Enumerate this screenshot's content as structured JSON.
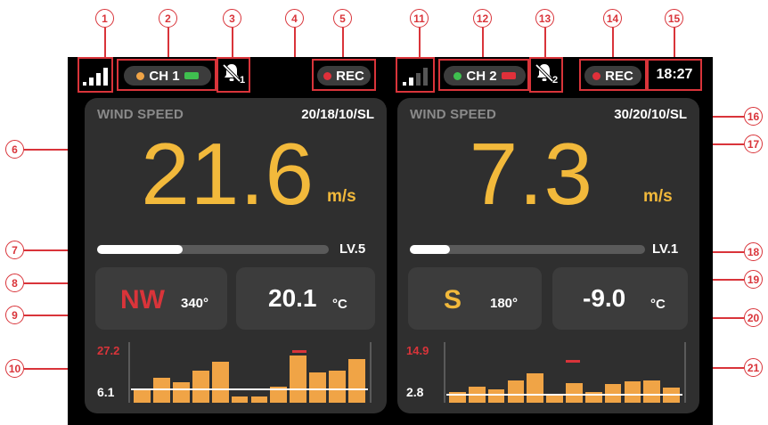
{
  "callouts": [
    "1",
    "2",
    "3",
    "4",
    "5",
    "6",
    "7",
    "8",
    "9",
    "10",
    "11",
    "12",
    "13",
    "14",
    "15",
    "16",
    "17",
    "18",
    "19",
    "20",
    "21"
  ],
  "status_bar": {
    "ch1": {
      "label": "CH 1",
      "dot_color": "#f0a446",
      "battery_color": "#3fbf4f"
    },
    "ch2": {
      "label": "CH 2",
      "dot_color": "#3fbf4f",
      "battery_color": "#e0303a"
    },
    "alarm1_sub": "1",
    "alarm2_sub": "2",
    "rec_label": "REC",
    "rec2_label": "REC",
    "time": "18:27"
  },
  "left_panel": {
    "title": "WIND SPEED",
    "code": "20/18/10/SL",
    "value": "21.6",
    "unit": "m/s",
    "level_fraction": 0.37,
    "level_label": "LV.5",
    "direction": "NW",
    "direction_color": "#d9343a",
    "degrees": "340°",
    "temperature": "20.1",
    "temp_unit": "°C",
    "hist_max": "27.2",
    "hist_min": "6.1",
    "hist_values": [
      0.25,
      0.42,
      0.35,
      0.55,
      0.7,
      0.1,
      0.1,
      0.28,
      0.8,
      0.52,
      0.55,
      0.75
    ]
  },
  "right_panel": {
    "title": "WIND SPEED",
    "code": "30/20/10/SL",
    "value": "7.3",
    "unit": "m/s",
    "level_fraction": 0.17,
    "level_label": "LV.1",
    "direction": "S",
    "direction_color": "#f2b93b",
    "degrees": "180°",
    "temperature": "-9.0",
    "temp_unit": "°C",
    "hist_max": "14.9",
    "hist_min": "2.8",
    "hist_values": [
      0.18,
      0.28,
      0.22,
      0.38,
      0.5,
      0.12,
      0.34,
      0.18,
      0.32,
      0.36,
      0.38,
      0.26
    ]
  }
}
